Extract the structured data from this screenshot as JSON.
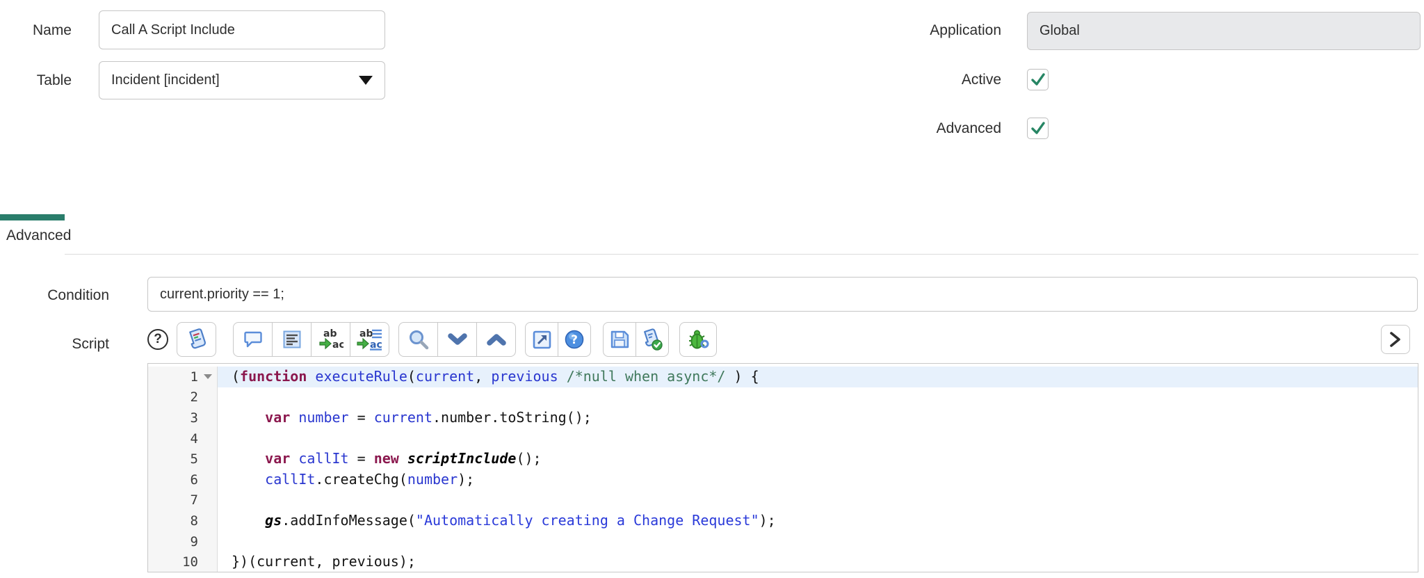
{
  "form": {
    "name": {
      "label": "Name",
      "value": "Call A Script Include"
    },
    "table": {
      "label": "Table",
      "value": "Incident [incident]"
    },
    "application": {
      "label": "Application",
      "value": "Global",
      "readonly": true
    },
    "active": {
      "label": "Active",
      "checked": true
    },
    "advanced": {
      "label": "Advanced",
      "checked": true
    }
  },
  "tabs": {
    "active_tab_label": "Advanced"
  },
  "advanced_section": {
    "condition": {
      "label": "Condition",
      "value": "current.priority == 1;"
    },
    "script": {
      "label": "Script"
    }
  },
  "toolbar": {
    "icons": [
      {
        "name": "help-circle-icon"
      },
      {
        "name": "syntax-editor-icon"
      },
      {
        "name": "comment-icon"
      },
      {
        "name": "format-code-icon"
      },
      {
        "name": "replace-icon"
      },
      {
        "name": "replace-all-icon"
      },
      {
        "name": "search-icon"
      },
      {
        "name": "find-next-icon"
      },
      {
        "name": "find-previous-icon"
      },
      {
        "name": "popout-icon"
      },
      {
        "name": "help-filled-icon"
      },
      {
        "name": "save-icon"
      },
      {
        "name": "validate-script-icon"
      },
      {
        "name": "debug-icon"
      },
      {
        "name": "expand-chevron-icon"
      }
    ]
  },
  "editor": {
    "active_line": 1,
    "fold_marker_line": 1,
    "lines": [
      [
        {
          "t": "(",
          "c": "p"
        },
        {
          "t": "function",
          "c": "k"
        },
        {
          "t": " ",
          "c": "p"
        },
        {
          "t": "executeRule",
          "c": "v"
        },
        {
          "t": "(",
          "c": "p"
        },
        {
          "t": "current",
          "c": "v"
        },
        {
          "t": ", ",
          "c": "p"
        },
        {
          "t": "previous",
          "c": "v"
        },
        {
          "t": " ",
          "c": "p"
        },
        {
          "t": "/*null when async*/",
          "c": "c"
        },
        {
          "t": " ) {",
          "c": "p"
        }
      ],
      [],
      [
        {
          "t": "    ",
          "c": "p"
        },
        {
          "t": "var",
          "c": "k"
        },
        {
          "t": " ",
          "c": "p"
        },
        {
          "t": "number",
          "c": "v"
        },
        {
          "t": " = ",
          "c": "p"
        },
        {
          "t": "current",
          "c": "v"
        },
        {
          "t": ".number.toString();",
          "c": "p"
        }
      ],
      [],
      [
        {
          "t": "    ",
          "c": "p"
        },
        {
          "t": "var",
          "c": "k"
        },
        {
          "t": " ",
          "c": "p"
        },
        {
          "t": "callIt",
          "c": "v"
        },
        {
          "t": " = ",
          "c": "p"
        },
        {
          "t": "new",
          "c": "k"
        },
        {
          "t": " ",
          "c": "p"
        },
        {
          "t": "scriptInclude",
          "c": "g"
        },
        {
          "t": "();",
          "c": "p"
        }
      ],
      [
        {
          "t": "    ",
          "c": "p"
        },
        {
          "t": "callIt",
          "c": "v"
        },
        {
          "t": ".createChg(",
          "c": "p"
        },
        {
          "t": "number",
          "c": "v"
        },
        {
          "t": ");",
          "c": "p"
        }
      ],
      [],
      [
        {
          "t": "    ",
          "c": "p"
        },
        {
          "t": "gs",
          "c": "g"
        },
        {
          "t": ".addInfoMessage(",
          "c": "p"
        },
        {
          "t": "\"Automatically creating a Change Request\"",
          "c": "s"
        },
        {
          "t": ");",
          "c": "p"
        }
      ],
      [],
      [
        {
          "t": "})(current, previous);",
          "c": "p"
        }
      ]
    ]
  },
  "colors": {
    "tab_accent": "#2a7d6b",
    "check_green": "#278664",
    "active_line_bg": "#e7f1fc",
    "keyword": "#8b184e",
    "variable": "#2936cf",
    "comment": "#40795c",
    "string": "#2a3ad9",
    "readonly_bg": "#e8e9eb"
  }
}
